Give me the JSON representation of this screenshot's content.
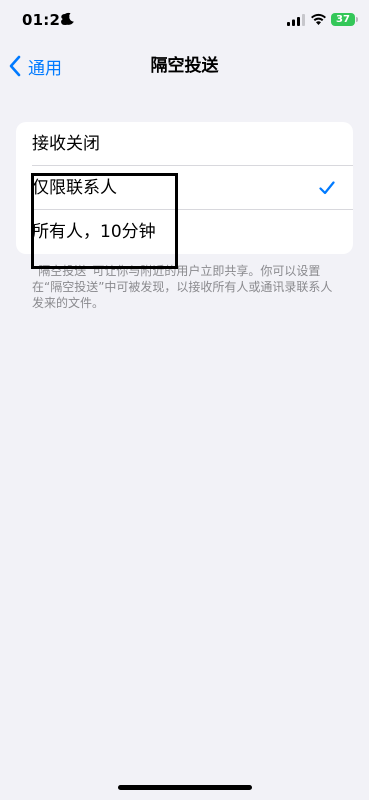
{
  "status_bar": {
    "time": "01:28",
    "battery": "37"
  },
  "nav": {
    "back_label": "通用",
    "title": "隔空投送"
  },
  "options": [
    {
      "label": "接收关闭",
      "selected": false
    },
    {
      "label": "仅限联系人",
      "selected": true
    },
    {
      "label": "所有人，10分钟",
      "selected": false
    }
  ],
  "footer_note": "“隔空投送”可让你与附近的用户立即共享。你可以设置在“隔空投送”中可被发现，以接收所有人或通讯录联系人发来的文件。",
  "colors": {
    "accent": "#007aff",
    "background": "#f2f2f7",
    "battery": "#34c759"
  }
}
